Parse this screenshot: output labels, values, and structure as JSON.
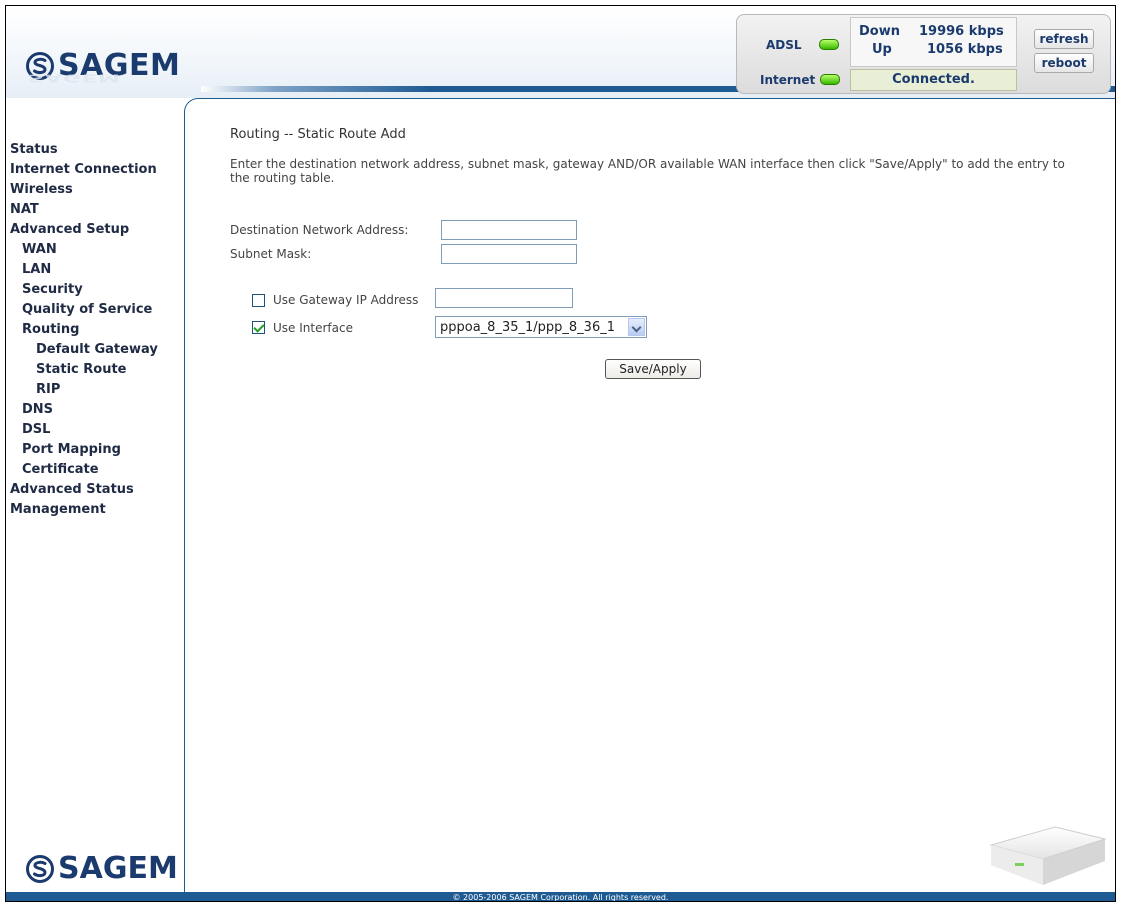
{
  "brand": {
    "name": "SAGEM",
    "color": "#1b3a6d"
  },
  "status_panel": {
    "adsl_label": "ADSL",
    "internet_label": "Internet",
    "down_label": "Down",
    "down_value": "19996 kbps",
    "up_label": "Up",
    "up_value": "1056 kbps",
    "connection_status": "Connected.",
    "refresh_label": "refresh",
    "reboot_label": "reboot",
    "led_color": "#39b800"
  },
  "sidebar": {
    "items": [
      {
        "label": "Status",
        "level": 0
      },
      {
        "label": "Internet Connection",
        "level": 0
      },
      {
        "label": "Wireless",
        "level": 0
      },
      {
        "label": "NAT",
        "level": 0
      },
      {
        "label": "Advanced Setup",
        "level": 0
      },
      {
        "label": "WAN",
        "level": 1
      },
      {
        "label": "LAN",
        "level": 1
      },
      {
        "label": "Security",
        "level": 1
      },
      {
        "label": "Quality of Service",
        "level": 1
      },
      {
        "label": "Routing",
        "level": 1
      },
      {
        "label": "Default Gateway",
        "level": 2
      },
      {
        "label": "Static Route",
        "level": 2
      },
      {
        "label": "RIP",
        "level": 2
      },
      {
        "label": "DNS",
        "level": 1
      },
      {
        "label": "DSL",
        "level": 1
      },
      {
        "label": "Port Mapping",
        "level": 1
      },
      {
        "label": "Certificate",
        "level": 1
      },
      {
        "label": "Advanced Status",
        "level": 0
      },
      {
        "label": "Management",
        "level": 0
      }
    ]
  },
  "main": {
    "title": "Routing -- Static Route Add",
    "description": "Enter the destination network address, subnet mask, gateway AND/OR available WAN interface then click \"Save/Apply\" to add the entry to the routing table.",
    "destination_label": "Destination Network Address:",
    "destination_value": "",
    "subnet_label": "Subnet Mask:",
    "subnet_value": "",
    "gateway_checkbox_label": "Use Gateway IP Address",
    "gateway_checked": false,
    "gateway_value": "",
    "interface_checkbox_label": "Use Interface",
    "interface_checked": true,
    "interface_selected": "pppoa_8_35_1/ppp_8_36_1",
    "save_label": "Save/Apply"
  },
  "footer": {
    "copyright": "© 2005-2006 SAGEM Corporation. All rights reserved."
  },
  "colors": {
    "accent": "#1f5b93"
  }
}
